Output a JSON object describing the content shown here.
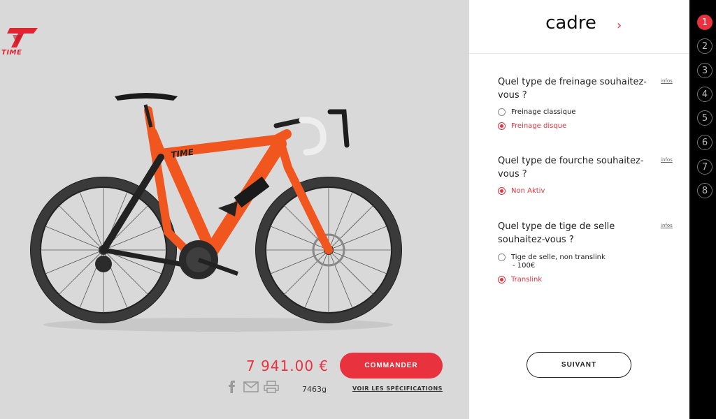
{
  "brand": {
    "name": "TIME"
  },
  "product": {
    "price": "7  941.00 €",
    "order_label": "COMMANDER",
    "weight": "7463g",
    "specs_link": "VOIR LES SPÉCIFICATIONS"
  },
  "share_icons": [
    "facebook-icon",
    "mail-icon",
    "print-icon"
  ],
  "config": {
    "title": "cadre",
    "next_arrow": "›",
    "questions": [
      {
        "text": "Quel type de freinage souhaitez-vous ?",
        "infos": "infos",
        "options": [
          {
            "label": "Freinage classique",
            "selected": false
          },
          {
            "label": "Freinage disque",
            "selected": true
          }
        ]
      },
      {
        "text": "Quel type de fourche souhaitez-vous ?",
        "infos": "infos",
        "options": [
          {
            "label": "Non Aktiv",
            "selected": true
          }
        ]
      },
      {
        "text": "Quel type de tige de selle souhaitez-vous ?",
        "infos": "infos",
        "options": [
          {
            "label": "Tige de selle, non translink",
            "sub": "- 100€",
            "selected": false
          },
          {
            "label": "Translink",
            "selected": true
          }
        ]
      }
    ],
    "next_label": "SUIVANT"
  },
  "steps": [
    "1",
    "2",
    "3",
    "4",
    "5",
    "6",
    "7",
    "8"
  ],
  "active_step": "1",
  "colors": {
    "accent": "#e8323e",
    "panel_bg": "#d9d9d9",
    "frame_orange": "#f0561e",
    "step_bar": "#000000"
  }
}
